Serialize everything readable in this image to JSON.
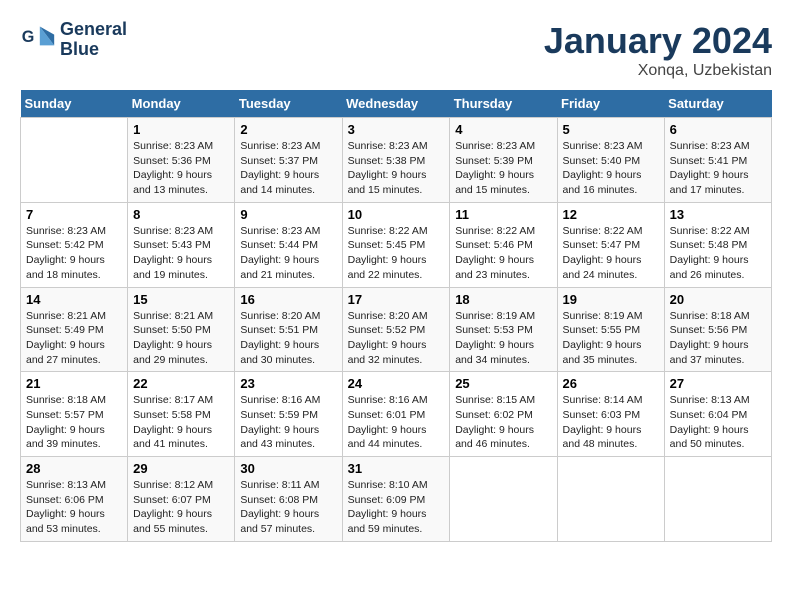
{
  "header": {
    "logo_line1": "General",
    "logo_line2": "Blue",
    "title": "January 2024",
    "subtitle": "Xonqa, Uzbekistan"
  },
  "days_of_week": [
    "Sunday",
    "Monday",
    "Tuesday",
    "Wednesday",
    "Thursday",
    "Friday",
    "Saturday"
  ],
  "weeks": [
    [
      {
        "day": "",
        "sunrise": "",
        "sunset": "",
        "daylight": ""
      },
      {
        "day": "1",
        "sunrise": "Sunrise: 8:23 AM",
        "sunset": "Sunset: 5:36 PM",
        "daylight": "Daylight: 9 hours and 13 minutes."
      },
      {
        "day": "2",
        "sunrise": "Sunrise: 8:23 AM",
        "sunset": "Sunset: 5:37 PM",
        "daylight": "Daylight: 9 hours and 14 minutes."
      },
      {
        "day": "3",
        "sunrise": "Sunrise: 8:23 AM",
        "sunset": "Sunset: 5:38 PM",
        "daylight": "Daylight: 9 hours and 15 minutes."
      },
      {
        "day": "4",
        "sunrise": "Sunrise: 8:23 AM",
        "sunset": "Sunset: 5:39 PM",
        "daylight": "Daylight: 9 hours and 15 minutes."
      },
      {
        "day": "5",
        "sunrise": "Sunrise: 8:23 AM",
        "sunset": "Sunset: 5:40 PM",
        "daylight": "Daylight: 9 hours and 16 minutes."
      },
      {
        "day": "6",
        "sunrise": "Sunrise: 8:23 AM",
        "sunset": "Sunset: 5:41 PM",
        "daylight": "Daylight: 9 hours and 17 minutes."
      }
    ],
    [
      {
        "day": "7",
        "sunrise": "Sunrise: 8:23 AM",
        "sunset": "Sunset: 5:42 PM",
        "daylight": "Daylight: 9 hours and 18 minutes."
      },
      {
        "day": "8",
        "sunrise": "Sunrise: 8:23 AM",
        "sunset": "Sunset: 5:43 PM",
        "daylight": "Daylight: 9 hours and 19 minutes."
      },
      {
        "day": "9",
        "sunrise": "Sunrise: 8:23 AM",
        "sunset": "Sunset: 5:44 PM",
        "daylight": "Daylight: 9 hours and 21 minutes."
      },
      {
        "day": "10",
        "sunrise": "Sunrise: 8:22 AM",
        "sunset": "Sunset: 5:45 PM",
        "daylight": "Daylight: 9 hours and 22 minutes."
      },
      {
        "day": "11",
        "sunrise": "Sunrise: 8:22 AM",
        "sunset": "Sunset: 5:46 PM",
        "daylight": "Daylight: 9 hours and 23 minutes."
      },
      {
        "day": "12",
        "sunrise": "Sunrise: 8:22 AM",
        "sunset": "Sunset: 5:47 PM",
        "daylight": "Daylight: 9 hours and 24 minutes."
      },
      {
        "day": "13",
        "sunrise": "Sunrise: 8:22 AM",
        "sunset": "Sunset: 5:48 PM",
        "daylight": "Daylight: 9 hours and 26 minutes."
      }
    ],
    [
      {
        "day": "14",
        "sunrise": "Sunrise: 8:21 AM",
        "sunset": "Sunset: 5:49 PM",
        "daylight": "Daylight: 9 hours and 27 minutes."
      },
      {
        "day": "15",
        "sunrise": "Sunrise: 8:21 AM",
        "sunset": "Sunset: 5:50 PM",
        "daylight": "Daylight: 9 hours and 29 minutes."
      },
      {
        "day": "16",
        "sunrise": "Sunrise: 8:20 AM",
        "sunset": "Sunset: 5:51 PM",
        "daylight": "Daylight: 9 hours and 30 minutes."
      },
      {
        "day": "17",
        "sunrise": "Sunrise: 8:20 AM",
        "sunset": "Sunset: 5:52 PM",
        "daylight": "Daylight: 9 hours and 32 minutes."
      },
      {
        "day": "18",
        "sunrise": "Sunrise: 8:19 AM",
        "sunset": "Sunset: 5:53 PM",
        "daylight": "Daylight: 9 hours and 34 minutes."
      },
      {
        "day": "19",
        "sunrise": "Sunrise: 8:19 AM",
        "sunset": "Sunset: 5:55 PM",
        "daylight": "Daylight: 9 hours and 35 minutes."
      },
      {
        "day": "20",
        "sunrise": "Sunrise: 8:18 AM",
        "sunset": "Sunset: 5:56 PM",
        "daylight": "Daylight: 9 hours and 37 minutes."
      }
    ],
    [
      {
        "day": "21",
        "sunrise": "Sunrise: 8:18 AM",
        "sunset": "Sunset: 5:57 PM",
        "daylight": "Daylight: 9 hours and 39 minutes."
      },
      {
        "day": "22",
        "sunrise": "Sunrise: 8:17 AM",
        "sunset": "Sunset: 5:58 PM",
        "daylight": "Daylight: 9 hours and 41 minutes."
      },
      {
        "day": "23",
        "sunrise": "Sunrise: 8:16 AM",
        "sunset": "Sunset: 5:59 PM",
        "daylight": "Daylight: 9 hours and 43 minutes."
      },
      {
        "day": "24",
        "sunrise": "Sunrise: 8:16 AM",
        "sunset": "Sunset: 6:01 PM",
        "daylight": "Daylight: 9 hours and 44 minutes."
      },
      {
        "day": "25",
        "sunrise": "Sunrise: 8:15 AM",
        "sunset": "Sunset: 6:02 PM",
        "daylight": "Daylight: 9 hours and 46 minutes."
      },
      {
        "day": "26",
        "sunrise": "Sunrise: 8:14 AM",
        "sunset": "Sunset: 6:03 PM",
        "daylight": "Daylight: 9 hours and 48 minutes."
      },
      {
        "day": "27",
        "sunrise": "Sunrise: 8:13 AM",
        "sunset": "Sunset: 6:04 PM",
        "daylight": "Daylight: 9 hours and 50 minutes."
      }
    ],
    [
      {
        "day": "28",
        "sunrise": "Sunrise: 8:13 AM",
        "sunset": "Sunset: 6:06 PM",
        "daylight": "Daylight: 9 hours and 53 minutes."
      },
      {
        "day": "29",
        "sunrise": "Sunrise: 8:12 AM",
        "sunset": "Sunset: 6:07 PM",
        "daylight": "Daylight: 9 hours and 55 minutes."
      },
      {
        "day": "30",
        "sunrise": "Sunrise: 8:11 AM",
        "sunset": "Sunset: 6:08 PM",
        "daylight": "Daylight: 9 hours and 57 minutes."
      },
      {
        "day": "31",
        "sunrise": "Sunrise: 8:10 AM",
        "sunset": "Sunset: 6:09 PM",
        "daylight": "Daylight: 9 hours and 59 minutes."
      },
      {
        "day": "",
        "sunrise": "",
        "sunset": "",
        "daylight": ""
      },
      {
        "day": "",
        "sunrise": "",
        "sunset": "",
        "daylight": ""
      },
      {
        "day": "",
        "sunrise": "",
        "sunset": "",
        "daylight": ""
      }
    ]
  ]
}
